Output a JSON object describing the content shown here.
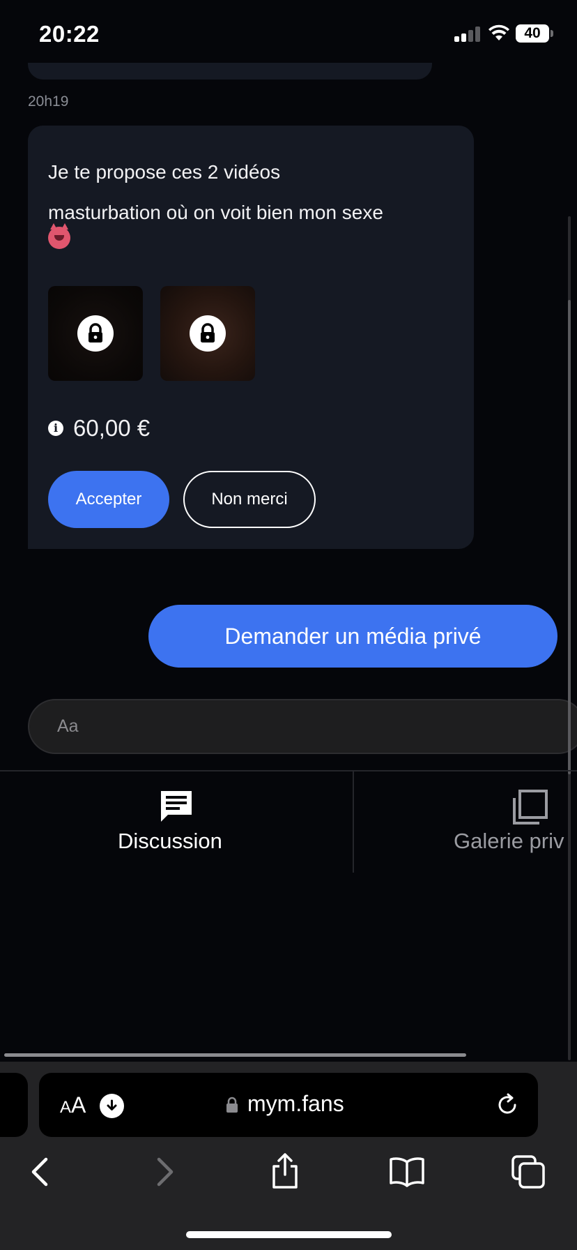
{
  "status_bar": {
    "time": "20:22",
    "battery": "40"
  },
  "chat": {
    "timestamp": "20h19",
    "offer": {
      "message_line1": "Je te propose ces 2 vidéos",
      "message_line2": "masturbation où on voit bien mon sexe",
      "price": "60,00 €",
      "accept_label": "Accepter",
      "decline_label": "Non merci"
    },
    "request_button_label": "Demander un média privé",
    "input_placeholder": "Aa"
  },
  "tabs": [
    {
      "label": "Discussion",
      "icon": "chat-icon",
      "active": true
    },
    {
      "label": "Galerie priv",
      "icon": "gallery-icon",
      "active": false
    }
  ],
  "browser": {
    "text_size_label_small": "A",
    "text_size_label_large": "A",
    "url": "mym.fans"
  },
  "colors": {
    "background": "#05060a",
    "bubble": "#151923",
    "accent": "#3d73f0",
    "browser_chrome": "#232325"
  }
}
